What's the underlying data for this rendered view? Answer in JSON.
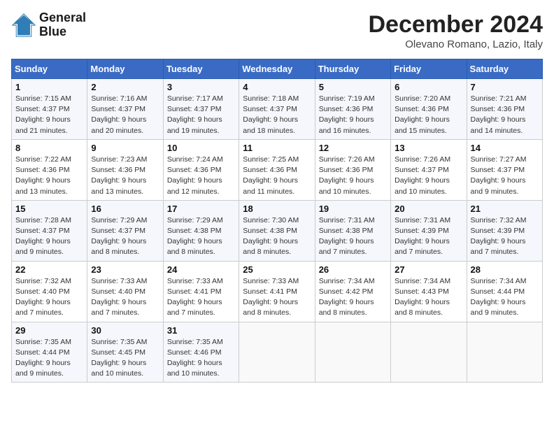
{
  "logo": {
    "line1": "General",
    "line2": "Blue"
  },
  "title": "December 2024",
  "location": "Olevano Romano, Lazio, Italy",
  "weekdays": [
    "Sunday",
    "Monday",
    "Tuesday",
    "Wednesday",
    "Thursday",
    "Friday",
    "Saturday"
  ],
  "weeks": [
    [
      {
        "day": "1",
        "info": "Sunrise: 7:15 AM\nSunset: 4:37 PM\nDaylight: 9 hours\nand 21 minutes."
      },
      {
        "day": "2",
        "info": "Sunrise: 7:16 AM\nSunset: 4:37 PM\nDaylight: 9 hours\nand 20 minutes."
      },
      {
        "day": "3",
        "info": "Sunrise: 7:17 AM\nSunset: 4:37 PM\nDaylight: 9 hours\nand 19 minutes."
      },
      {
        "day": "4",
        "info": "Sunrise: 7:18 AM\nSunset: 4:37 PM\nDaylight: 9 hours\nand 18 minutes."
      },
      {
        "day": "5",
        "info": "Sunrise: 7:19 AM\nSunset: 4:36 PM\nDaylight: 9 hours\nand 16 minutes."
      },
      {
        "day": "6",
        "info": "Sunrise: 7:20 AM\nSunset: 4:36 PM\nDaylight: 9 hours\nand 15 minutes."
      },
      {
        "day": "7",
        "info": "Sunrise: 7:21 AM\nSunset: 4:36 PM\nDaylight: 9 hours\nand 14 minutes."
      }
    ],
    [
      {
        "day": "8",
        "info": "Sunrise: 7:22 AM\nSunset: 4:36 PM\nDaylight: 9 hours\nand 13 minutes."
      },
      {
        "day": "9",
        "info": "Sunrise: 7:23 AM\nSunset: 4:36 PM\nDaylight: 9 hours\nand 13 minutes."
      },
      {
        "day": "10",
        "info": "Sunrise: 7:24 AM\nSunset: 4:36 PM\nDaylight: 9 hours\nand 12 minutes."
      },
      {
        "day": "11",
        "info": "Sunrise: 7:25 AM\nSunset: 4:36 PM\nDaylight: 9 hours\nand 11 minutes."
      },
      {
        "day": "12",
        "info": "Sunrise: 7:26 AM\nSunset: 4:36 PM\nDaylight: 9 hours\nand 10 minutes."
      },
      {
        "day": "13",
        "info": "Sunrise: 7:26 AM\nSunset: 4:37 PM\nDaylight: 9 hours\nand 10 minutes."
      },
      {
        "day": "14",
        "info": "Sunrise: 7:27 AM\nSunset: 4:37 PM\nDaylight: 9 hours\nand 9 minutes."
      }
    ],
    [
      {
        "day": "15",
        "info": "Sunrise: 7:28 AM\nSunset: 4:37 PM\nDaylight: 9 hours\nand 9 minutes."
      },
      {
        "day": "16",
        "info": "Sunrise: 7:29 AM\nSunset: 4:37 PM\nDaylight: 9 hours\nand 8 minutes."
      },
      {
        "day": "17",
        "info": "Sunrise: 7:29 AM\nSunset: 4:38 PM\nDaylight: 9 hours\nand 8 minutes."
      },
      {
        "day": "18",
        "info": "Sunrise: 7:30 AM\nSunset: 4:38 PM\nDaylight: 9 hours\nand 8 minutes."
      },
      {
        "day": "19",
        "info": "Sunrise: 7:31 AM\nSunset: 4:38 PM\nDaylight: 9 hours\nand 7 minutes."
      },
      {
        "day": "20",
        "info": "Sunrise: 7:31 AM\nSunset: 4:39 PM\nDaylight: 9 hours\nand 7 minutes."
      },
      {
        "day": "21",
        "info": "Sunrise: 7:32 AM\nSunset: 4:39 PM\nDaylight: 9 hours\nand 7 minutes."
      }
    ],
    [
      {
        "day": "22",
        "info": "Sunrise: 7:32 AM\nSunset: 4:40 PM\nDaylight: 9 hours\nand 7 minutes."
      },
      {
        "day": "23",
        "info": "Sunrise: 7:33 AM\nSunset: 4:40 PM\nDaylight: 9 hours\nand 7 minutes."
      },
      {
        "day": "24",
        "info": "Sunrise: 7:33 AM\nSunset: 4:41 PM\nDaylight: 9 hours\nand 7 minutes."
      },
      {
        "day": "25",
        "info": "Sunrise: 7:33 AM\nSunset: 4:41 PM\nDaylight: 9 hours\nand 8 minutes."
      },
      {
        "day": "26",
        "info": "Sunrise: 7:34 AM\nSunset: 4:42 PM\nDaylight: 9 hours\nand 8 minutes."
      },
      {
        "day": "27",
        "info": "Sunrise: 7:34 AM\nSunset: 4:43 PM\nDaylight: 9 hours\nand 8 minutes."
      },
      {
        "day": "28",
        "info": "Sunrise: 7:34 AM\nSunset: 4:44 PM\nDaylight: 9 hours\nand 9 minutes."
      }
    ],
    [
      {
        "day": "29",
        "info": "Sunrise: 7:35 AM\nSunset: 4:44 PM\nDaylight: 9 hours\nand 9 minutes."
      },
      {
        "day": "30",
        "info": "Sunrise: 7:35 AM\nSunset: 4:45 PM\nDaylight: 9 hours\nand 10 minutes."
      },
      {
        "day": "31",
        "info": "Sunrise: 7:35 AM\nSunset: 4:46 PM\nDaylight: 9 hours\nand 10 minutes."
      },
      null,
      null,
      null,
      null
    ]
  ]
}
